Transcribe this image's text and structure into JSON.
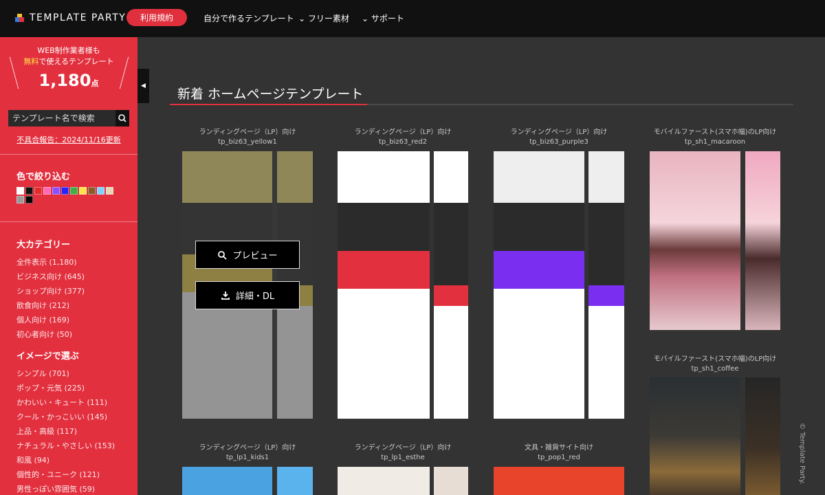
{
  "brand": {
    "name": "TEMPLATE PARTY"
  },
  "nav": {
    "terms": "利用規約",
    "custom": "自分で作るテンプレート",
    "free": "フリー素材",
    "support": "サポート"
  },
  "sidebar": {
    "promo_line1": "WEB制作業者様も",
    "promo_free": "無料",
    "promo_rest": "で使えるテンプレート",
    "count": "1,180",
    "count_unit": "点",
    "search_placeholder": "テンプレート名で検索",
    "report": "不具合報告：2024/11/16更新",
    "color_title": "色で絞り込む",
    "swatch_colors": [
      "#ffffff",
      "#111111",
      "#e12a2a",
      "#ff69b4",
      "#8a4fff",
      "#2424ff",
      "#3cb043",
      "#ffe44d",
      "#8b5a2b",
      "#7fd4ff",
      "#e6d5b8",
      "#999999",
      "#000000"
    ],
    "cat_title": "大カテゴリー",
    "categories": [
      "全件表示 (1,180)",
      "ビジネス向け (645)",
      "ショップ向け (377)",
      "飲食向け (212)",
      "個人向け (169)",
      "初心者向け (50)"
    ],
    "image_title": "イメージで選ぶ",
    "images": [
      "シンプル (701)",
      "ポップ・元気 (225)",
      "かわいい・キュート (111)",
      "クール・かっこいい (145)",
      "上品・高級 (117)",
      "ナチュラル・やさしい (153)",
      "和風 (94)",
      "個性的・ユニーク (121)",
      "男性っぽい雰囲気 (59)"
    ]
  },
  "main": {
    "heading": "新着 ホームページテンプレート",
    "cards": [
      {
        "cat": "ランディングページ（LP）向け",
        "id": "tp_biz63_yellow1"
      },
      {
        "cat": "ランディングページ（LP）向け",
        "id": "tp_biz63_red2"
      },
      {
        "cat": "ランディングページ（LP）向け",
        "id": "tp_biz63_purple3"
      },
      {
        "cat": "モバイルファースト(スマホ幅)のLP向け",
        "id": "tp_sh1_macaroon"
      },
      {
        "cat": "モバイルファースト(スマホ幅)のLP向け",
        "id": "tp_sh1_coffee"
      },
      {
        "cat": "ランディングページ（LP）向け",
        "id": "tp_lp1_kids1"
      },
      {
        "cat": "ランディングページ（LP）向け",
        "id": "tp_lp1_esthe"
      },
      {
        "cat": "文具・雑貨サイト向け",
        "id": "tp_pop1_red"
      }
    ],
    "preview_label": "プレビュー",
    "download_label": "詳細・DL"
  },
  "copyright": "© Template Party."
}
